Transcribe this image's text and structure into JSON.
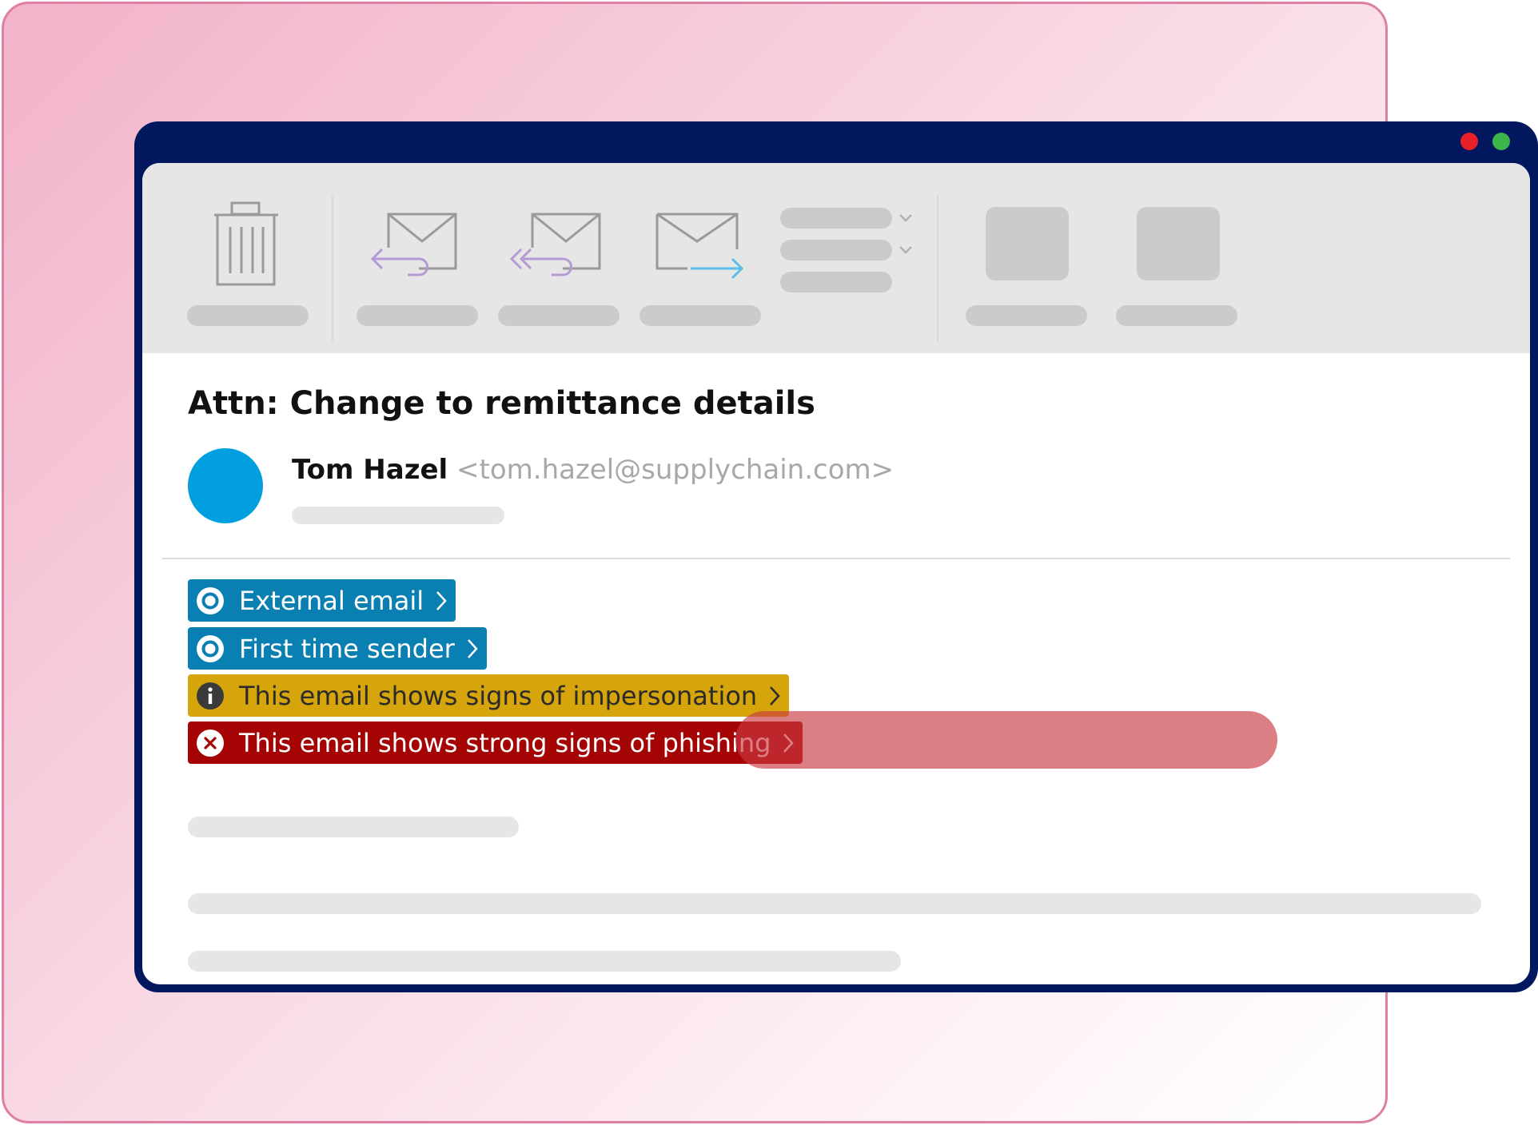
{
  "email": {
    "subject": "Attn: Change to remittance details",
    "sender": {
      "name": "Tom Hazel",
      "email": "<tom.hazel@supplychain.com>",
      "avatar_color": "#019fe0"
    }
  },
  "toolbar": {
    "icons": [
      "trash-icon",
      "reply-icon",
      "reply-all-icon",
      "forward-icon",
      "menu-lines",
      "placeholder-square"
    ]
  },
  "banners": [
    {
      "label": "External email",
      "icon": "ring-icon",
      "color": "#0a7fb1"
    },
    {
      "label": "First time sender",
      "icon": "ring-icon",
      "color": "#0a7fb1"
    },
    {
      "label": "This email shows signs of impersonation",
      "icon": "info-icon",
      "color": "#d6a40b"
    },
    {
      "label": "This email shows strong signs of phishing",
      "icon": "x-circle-icon",
      "color": "#a50404"
    }
  ],
  "colors": {
    "titlebar": "#02175e",
    "close_dot": "#e8202a",
    "maximize_dot": "#3cb54a",
    "highlight": "#c93a42"
  }
}
